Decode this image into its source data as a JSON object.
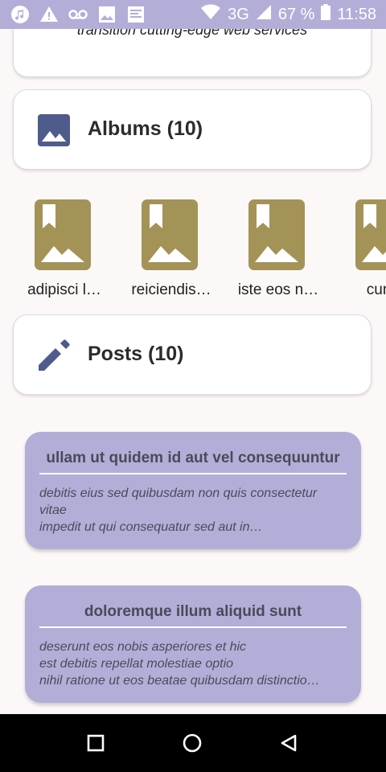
{
  "status_bar": {
    "icons_left": [
      "music-icon",
      "warning-icon",
      "voicemail-icon",
      "image-icon",
      "news-icon"
    ],
    "network": "3G",
    "battery": "67 %",
    "time": "11:58",
    "bg_color": "#b3aed8"
  },
  "top_card": {
    "tagline": "transition cutting-edge web services"
  },
  "albums_section": {
    "icon": "image-icon",
    "title": "Albums (10)",
    "icon_color": "#4f5b8a"
  },
  "albums": [
    {
      "label": "adipisci l…"
    },
    {
      "label": "reiciendis…"
    },
    {
      "label": "iste eos n…"
    },
    {
      "label": "cumq"
    }
  ],
  "album_thumb_color": "#a39357",
  "posts_section": {
    "icon": "pencil-icon",
    "title": "Posts (10)"
  },
  "posts": [
    {
      "title": "ullam ut quidem id aut vel consequuntur",
      "body": [
        "debitis eius sed quibusdam non quis consectetur",
        "vitae",
        "impedit ut qui consequatur sed aut in…"
      ]
    },
    {
      "title": "doloremque illum aliquid sunt",
      "body": [
        "deserunt eos nobis asperiores et hic",
        "est debitis repellat molestiae optio",
        "nihil ratione ut eos beatae quibusdam distinctio…"
      ]
    }
  ],
  "post_card_color": "#b3aed8",
  "nav_bar": {
    "buttons": [
      "recent-apps-icon",
      "home-icon",
      "back-icon"
    ]
  }
}
